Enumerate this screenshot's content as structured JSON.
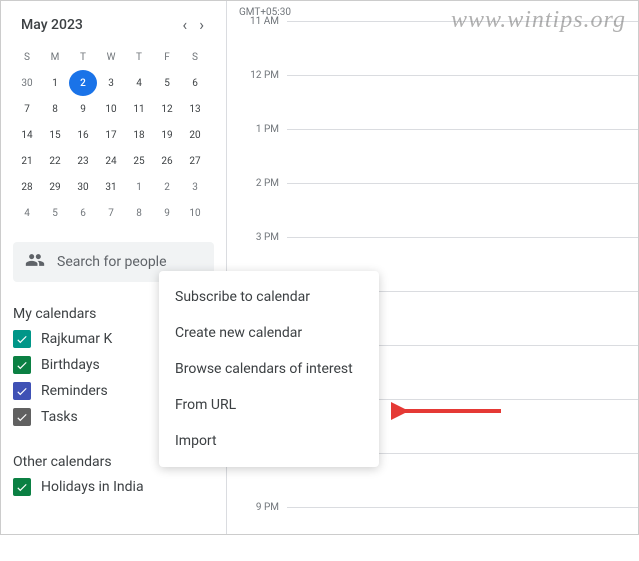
{
  "watermark": "www.wintips.org",
  "calendar": {
    "month_label": "May 2023",
    "timezone": "GMT+05:30",
    "day_headers": [
      "S",
      "M",
      "T",
      "W",
      "T",
      "F",
      "S"
    ],
    "weeks": [
      [
        "30",
        "1",
        "2",
        "3",
        "4",
        "5",
        "6"
      ],
      [
        "7",
        "8",
        "9",
        "10",
        "11",
        "12",
        "13"
      ],
      [
        "14",
        "15",
        "16",
        "17",
        "18",
        "19",
        "20"
      ],
      [
        "21",
        "22",
        "23",
        "24",
        "25",
        "26",
        "27"
      ],
      [
        "28",
        "29",
        "30",
        "31",
        "1",
        "2",
        "3"
      ],
      [
        "4",
        "5",
        "6",
        "7",
        "8",
        "9",
        "10"
      ]
    ],
    "today_index": [
      0,
      2
    ]
  },
  "search": {
    "placeholder": "Search for people"
  },
  "sections": {
    "my_calendars": "My calendars",
    "other_calendars": "Other calendars"
  },
  "my_calendars": [
    {
      "label": "Rajkumar K",
      "color": "teal"
    },
    {
      "label": "Birthdays",
      "color": "green"
    },
    {
      "label": "Reminders",
      "color": "blue"
    },
    {
      "label": "Tasks",
      "color": "grey"
    }
  ],
  "other_calendars_list": [
    {
      "label": "Holidays in India",
      "color": "green"
    }
  ],
  "time_slots": [
    "11 AM",
    "12 PM",
    "1 PM",
    "2 PM",
    "3 PM",
    "",
    "",
    "",
    "",
    "9 PM"
  ],
  "context_menu": {
    "items": [
      "Subscribe to calendar",
      "Create new calendar",
      "Browse calendars of interest",
      "From URL",
      "Import"
    ]
  }
}
